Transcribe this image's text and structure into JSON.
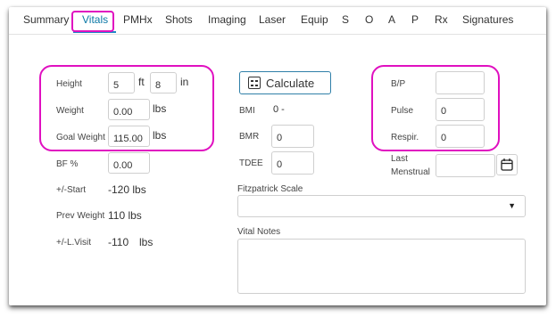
{
  "tabs": [
    "Summary",
    "Vitals",
    "PMHx",
    "Shots",
    "Imaging",
    "Laser",
    "Equip",
    "S",
    "O",
    "A",
    "P",
    "Rx",
    "Signatures"
  ],
  "active_tab": "Vitals",
  "left": {
    "height_label": "Height",
    "height_ft": "5",
    "ft_unit": "ft",
    "height_in": "8",
    "in_unit": "in",
    "weight_label": "Weight",
    "weight_value": "0.00",
    "weight_unit": "lbs",
    "goal_label": "Goal Weight",
    "goal_value": "115.00",
    "goal_unit": "lbs",
    "bf_label": "BF %",
    "bf_value": "0.00",
    "start_label": "+/-Start",
    "start_value": "-120 lbs",
    "prev_label": "Prev Weight",
    "prev_value": "110 lbs",
    "lvisit_label": "+/-L.Visit",
    "lvisit_value": "-110",
    "lvisit_unit": "lbs"
  },
  "middle": {
    "calculate_label": "Calculate",
    "bmi_label": "BMI",
    "bmi_value": "0 -",
    "bmr_label": "BMR",
    "bmr_value": "0",
    "tdee_label": "TDEE",
    "tdee_value": "0",
    "fitz_label": "Fitzpatrick Scale",
    "fitz_value": "",
    "notes_label": "Vital Notes",
    "notes_value": ""
  },
  "right": {
    "bp_label": "B/P",
    "bp_value": "",
    "pulse_label": "Pulse",
    "pulse_value": "0",
    "respir_label": "Respir.",
    "respir_value": "0",
    "menstrual_label_1": "Last",
    "menstrual_label_2": "Menstrual",
    "menstrual_value": ""
  },
  "colors": {
    "highlight": "#e010c0",
    "active_tab": "#0b78a6",
    "button_border": "#2f7fa8"
  },
  "icons": {
    "calculate": "calculator-icon",
    "calendar": "calendar-icon",
    "select": "chevron-down-icon"
  }
}
